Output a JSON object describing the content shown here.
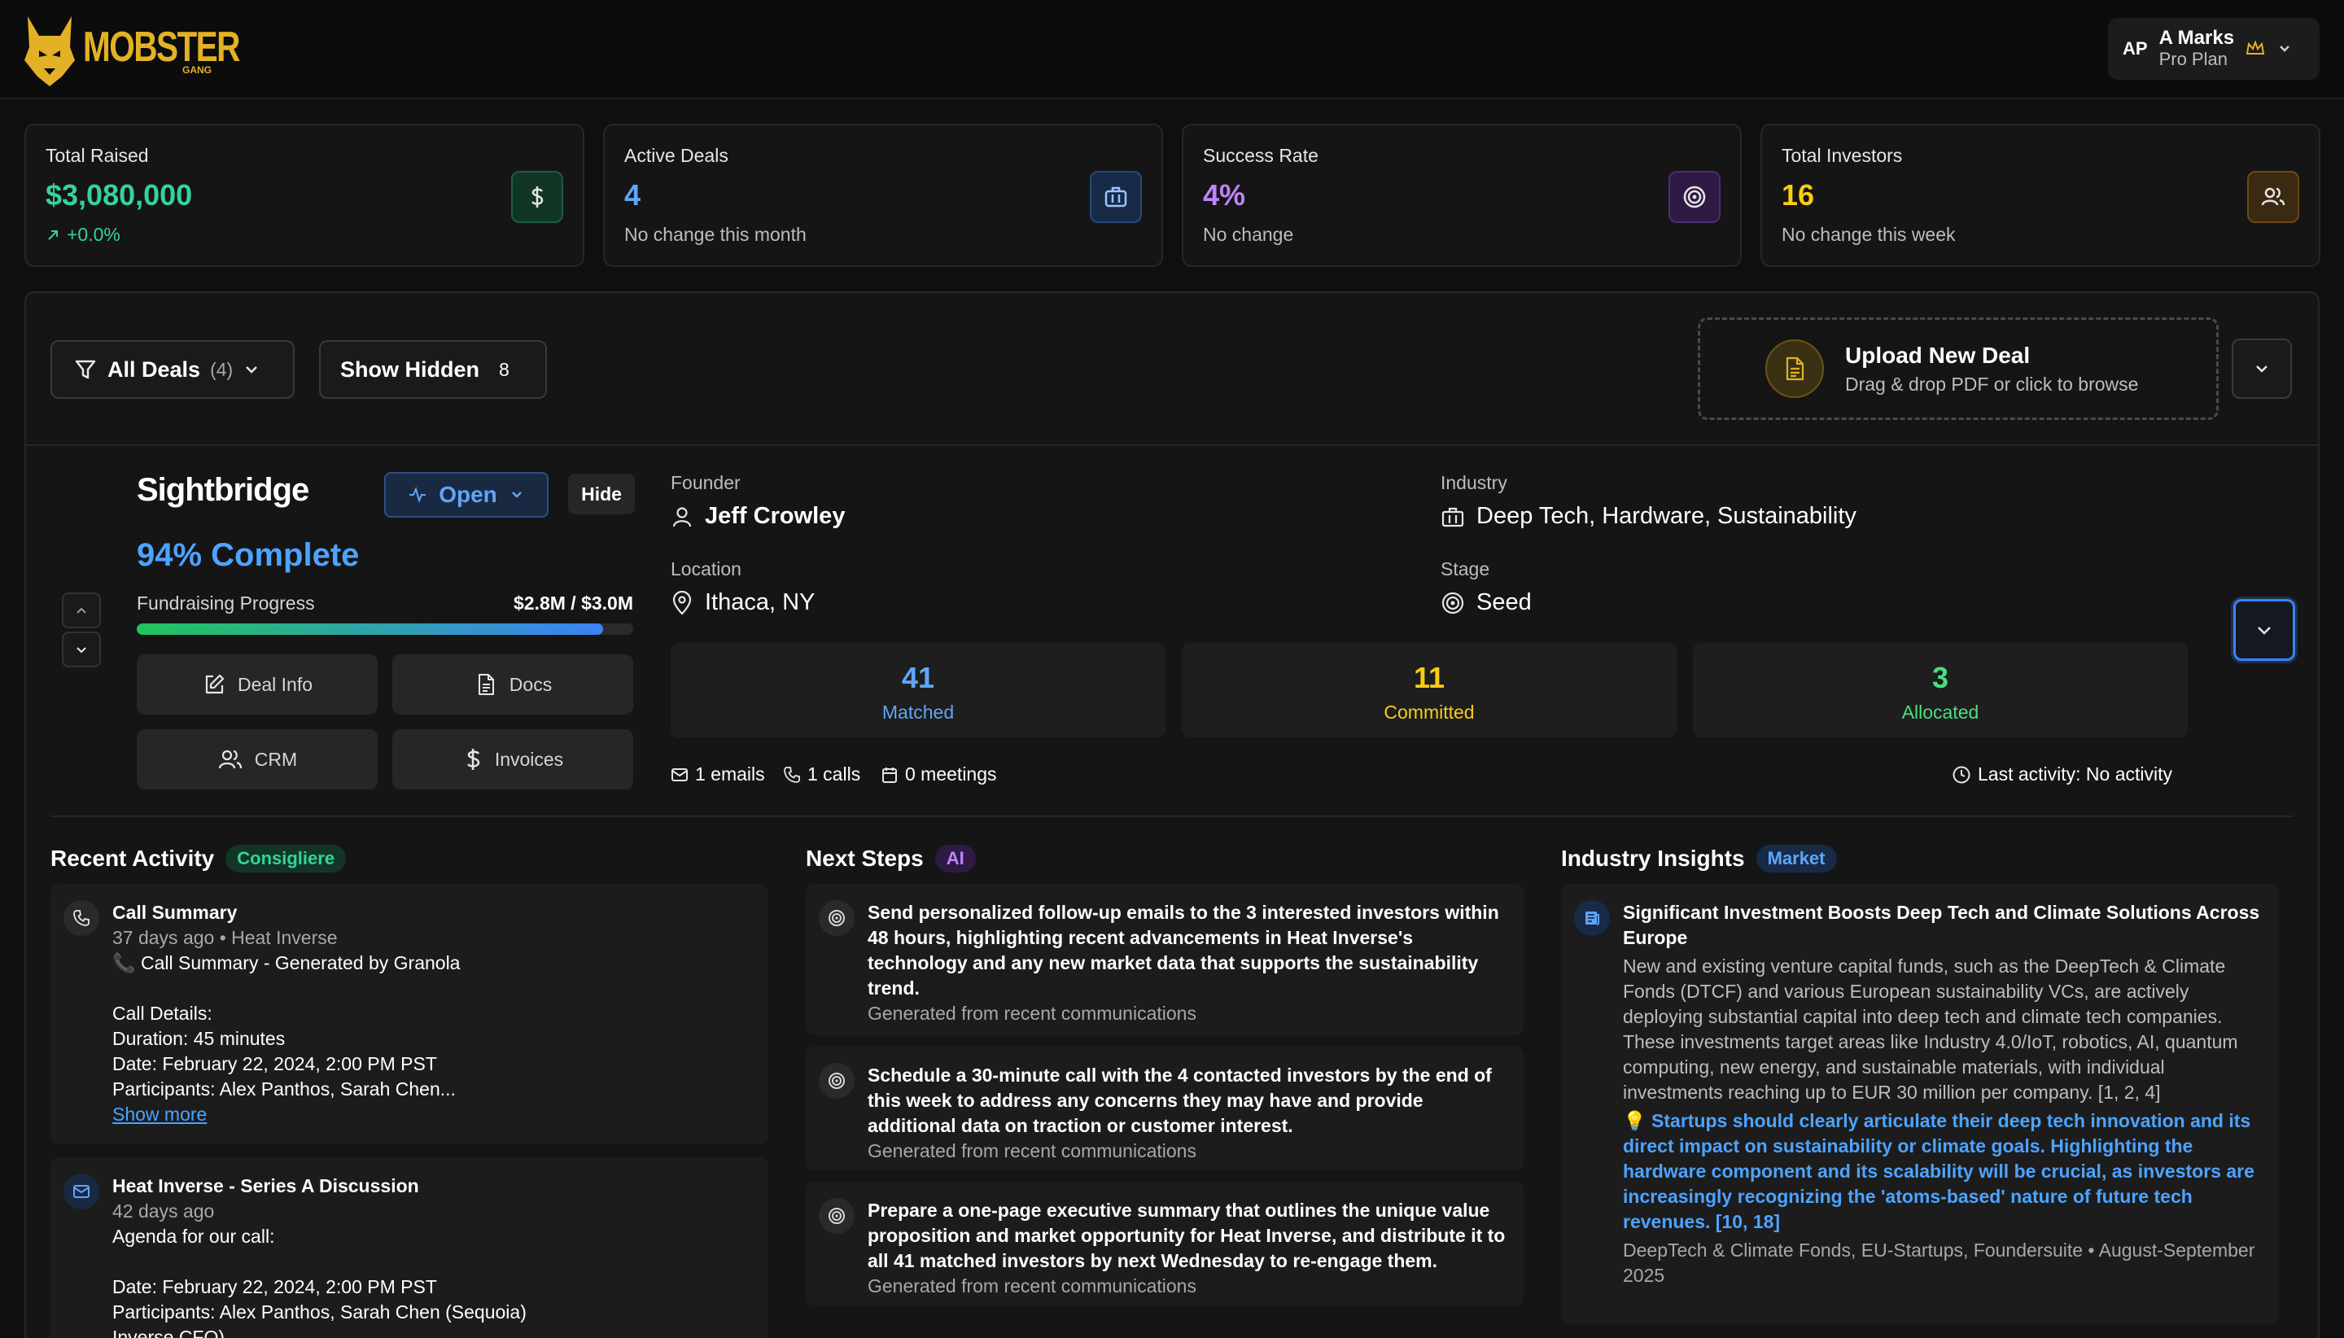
{
  "brand": {
    "name": "MOBSTER",
    "sub": "GANG",
    "color": "#e3b125"
  },
  "user": {
    "initials": "AP",
    "name": "A Marks",
    "plan": "Pro Plan"
  },
  "stats": [
    {
      "label": "Total Raised",
      "value": "$3,080,000",
      "sub": "+0.0%",
      "icon": "dollar-icon",
      "color": "#34d399"
    },
    {
      "label": "Active Deals",
      "value": "4",
      "sub": "No change this month",
      "icon": "briefcase-icon",
      "color": "#60a5fa"
    },
    {
      "label": "Success Rate",
      "value": "4%",
      "sub": "No change",
      "icon": "target-icon",
      "color": "#c084fc"
    },
    {
      "label": "Total Investors",
      "value": "16",
      "sub": "No change this week",
      "icon": "users-icon",
      "color": "#facc15"
    }
  ],
  "toolbar": {
    "all_deals": "All Deals",
    "all_deals_count": "(4)",
    "show_hidden": "Show Hidden",
    "hidden_count": "8"
  },
  "upload": {
    "title": "Upload New Deal",
    "subtitle": "Drag & drop PDF or click to browse"
  },
  "deal": {
    "name": "Sightbridge",
    "status": "Open",
    "hide_label": "Hide",
    "complete": "94% Complete",
    "progress_label": "Fundraising Progress",
    "progress_amount": "$2.8M / $3.0M",
    "progress": 0.94,
    "actions": [
      "Deal Info",
      "Docs",
      "CRM",
      "Invoices"
    ],
    "founder_label": "Founder",
    "founder": "Jeff Crowley",
    "industry_label": "Industry",
    "industry": "Deep Tech, Hardware, Sustainability",
    "location_label": "Location",
    "location": "Ithaca, NY",
    "stage_label": "Stage",
    "stage": "Seed",
    "counts": [
      {
        "value": "41",
        "label": "Matched",
        "color": "#60a5fa"
      },
      {
        "value": "11",
        "label": "Committed",
        "color": "#facc15"
      },
      {
        "value": "3",
        "label": "Allocated",
        "color": "#4ade80"
      }
    ],
    "emails": "1 emails",
    "calls": "1 calls",
    "meetings": "0 meetings",
    "last_activity": "Last activity: No activity"
  },
  "recent_activity": {
    "title": "Recent Activity",
    "tag": "Consigliere",
    "items": [
      {
        "title": "Call Summary",
        "meta": "37 days ago • Heat Inverse",
        "lines": [
          "📞 Call Summary - Generated by Granola",
          "",
          "Call Details:",
          "Duration: 45 minutes",
          "Date: February 22, 2024, 2:00 PM PST",
          "Participants: Alex Panthos, Sarah Chen..."
        ],
        "more": "Show more"
      },
      {
        "title": "Heat Inverse - Series A Discussion",
        "meta": "42 days ago",
        "lines": [
          "Agenda for our call:",
          "",
          "Date: February 22, 2024, 2:00 PM PST",
          "Participants: Alex Panthos, Sarah Chen (Sequoia)",
          "Inverse CFO)"
        ]
      }
    ]
  },
  "next_steps": {
    "title": "Next Steps",
    "tag": "AI",
    "items": [
      {
        "text": "Send personalized follow-up emails to the 3 interested investors within 48 hours, highlighting recent advancements in Heat Inverse's technology and any new market data that supports the sustainability trend.",
        "source": "Generated from recent communications"
      },
      {
        "text": "Schedule a 30-minute call with the 4 contacted investors by the end of this week to address any concerns they may have and provide additional data on traction or customer interest.",
        "source": "Generated from recent communications"
      },
      {
        "text": "Prepare a one-page executive summary that outlines the unique value proposition and market opportunity for Heat Inverse, and distribute it to all 41 matched investors by next Wednesday to re-engage them.",
        "source": "Generated from recent communications"
      }
    ]
  },
  "insights": {
    "title": "Industry Insights",
    "tag": "Market",
    "item": {
      "title": "Significant Investment Boosts Deep Tech and Climate Solutions Across Europe",
      "body": "New and existing venture capital funds, such as the DeepTech & Climate Fonds (DTCF) and various European sustainability VCs, are actively deploying substantial capital into deep tech and climate tech companies. These investments target areas like Industry 4.0/IoT, robotics, AI, quantum computing, new energy, and sustainable materials, with individual investments reaching up to EUR 30 million per company. [1, 2, 4]",
      "tip": "💡 Startups should clearly articulate their deep tech innovation and its direct impact on sustainability or climate goals. Highlighting the hardware component and its scalability will be crucial, as investors are increasingly recognizing the 'atoms-based' nature of future tech revenues. [10, 18]",
      "source": "DeepTech & Climate Fonds, EU-Startups, Foundersuite • August-September 2025"
    }
  }
}
